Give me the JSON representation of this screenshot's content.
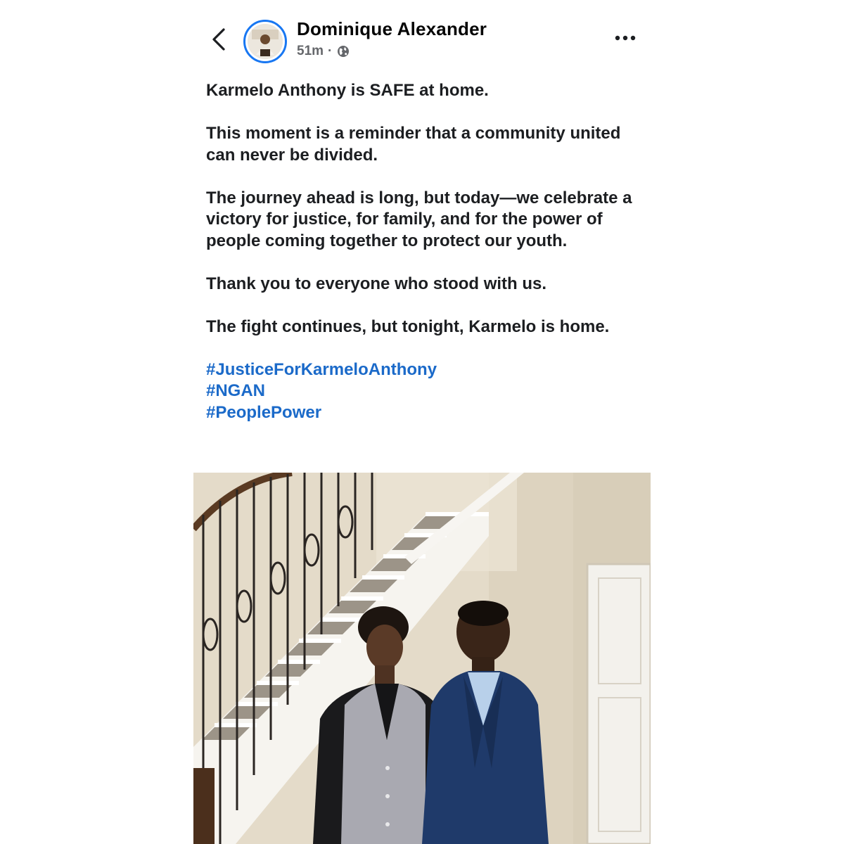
{
  "post": {
    "author": "Dominique Alexander",
    "time": "51m",
    "separator": "·",
    "privacy_icon": "globe-icon",
    "paragraphs": [
      "Karmelo Anthony is SAFE at home.",
      "This moment is a reminder that a community united can never be divided.",
      "The journey ahead is long, but today—we celebrate a victory for justice, for family, and for the power of people coming together to protect our youth.",
      "Thank you to everyone who stood with us.",
      "The fight continues, but tonight, Karmelo is home."
    ],
    "hashtags": [
      "#JusticeForKarmeloAnthony",
      "#NGAN",
      "#PeoplePower"
    ]
  },
  "icons": {
    "back": "chevron-left-icon",
    "more": "more-options-icon"
  },
  "colors": {
    "hashtag": "#1b6ac9",
    "avatar_ring": "#1877f2",
    "meta_text": "#65676b"
  }
}
